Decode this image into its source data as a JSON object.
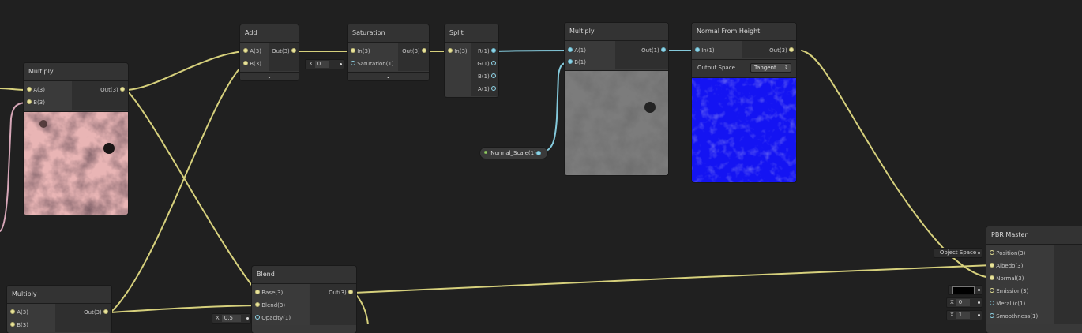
{
  "colors": {
    "background": "#202020",
    "node_body": "#393939",
    "wire_vector3": "#d6d07c",
    "wire_vector1": "#84c9db",
    "wire_pink": "#d7a7b8"
  },
  "nodes": {
    "multiply_1": {
      "title": "Multiply",
      "inputs": [
        "A(3)",
        "B(3)"
      ],
      "outputs": [
        "Out(3)"
      ]
    },
    "multiply_2": {
      "title": "Multiply",
      "inputs": [
        "A(3)",
        "B(3)"
      ],
      "outputs": [
        "Out(3)"
      ]
    },
    "add": {
      "title": "Add",
      "inputs": [
        "A(3)",
        "B(3)"
      ],
      "outputs": [
        "Out(3)"
      ]
    },
    "saturation": {
      "title": "Saturation",
      "inputs": [
        "In(3)",
        "Saturation(1)"
      ],
      "outputs": [
        "Out(3)"
      ],
      "inline_axis": "X",
      "inline_value": "0"
    },
    "split": {
      "title": "Split",
      "inputs": [
        "In(3)"
      ],
      "outputs": [
        "R(1)",
        "G(1)",
        "B(1)",
        "A(1)"
      ]
    },
    "multiply_3": {
      "title": "Multiply",
      "inputs": [
        "A(1)",
        "B(1)"
      ],
      "outputs": [
        "Out(1)"
      ]
    },
    "normal_from_height": {
      "title": "Normal From Height",
      "inputs": [
        "In(1)"
      ],
      "outputs": [
        "Out(3)"
      ],
      "option_label": "Output Space",
      "option_value": "Tangent"
    },
    "normal_scale": {
      "label": "Normal_Scale(1)"
    },
    "blend": {
      "title": "Blend",
      "inputs": [
        "Base(3)",
        "Blend(3)",
        "Opacity(1)"
      ],
      "outputs": [
        "Out(3)"
      ],
      "inline_axis": "X",
      "inline_value": "0.5"
    },
    "pbr_master": {
      "title": "PBR Master",
      "inputs": [
        "Position(3)",
        "Albedo(3)",
        "Normal(3)",
        "Emission(3)",
        "Metallic(1)",
        "Smoothness(1)"
      ],
      "position_space": "Object Space",
      "metallic_axis": "X",
      "metallic_value": "0",
      "smoothness_axis": "X",
      "smoothness_value": "1"
    }
  }
}
